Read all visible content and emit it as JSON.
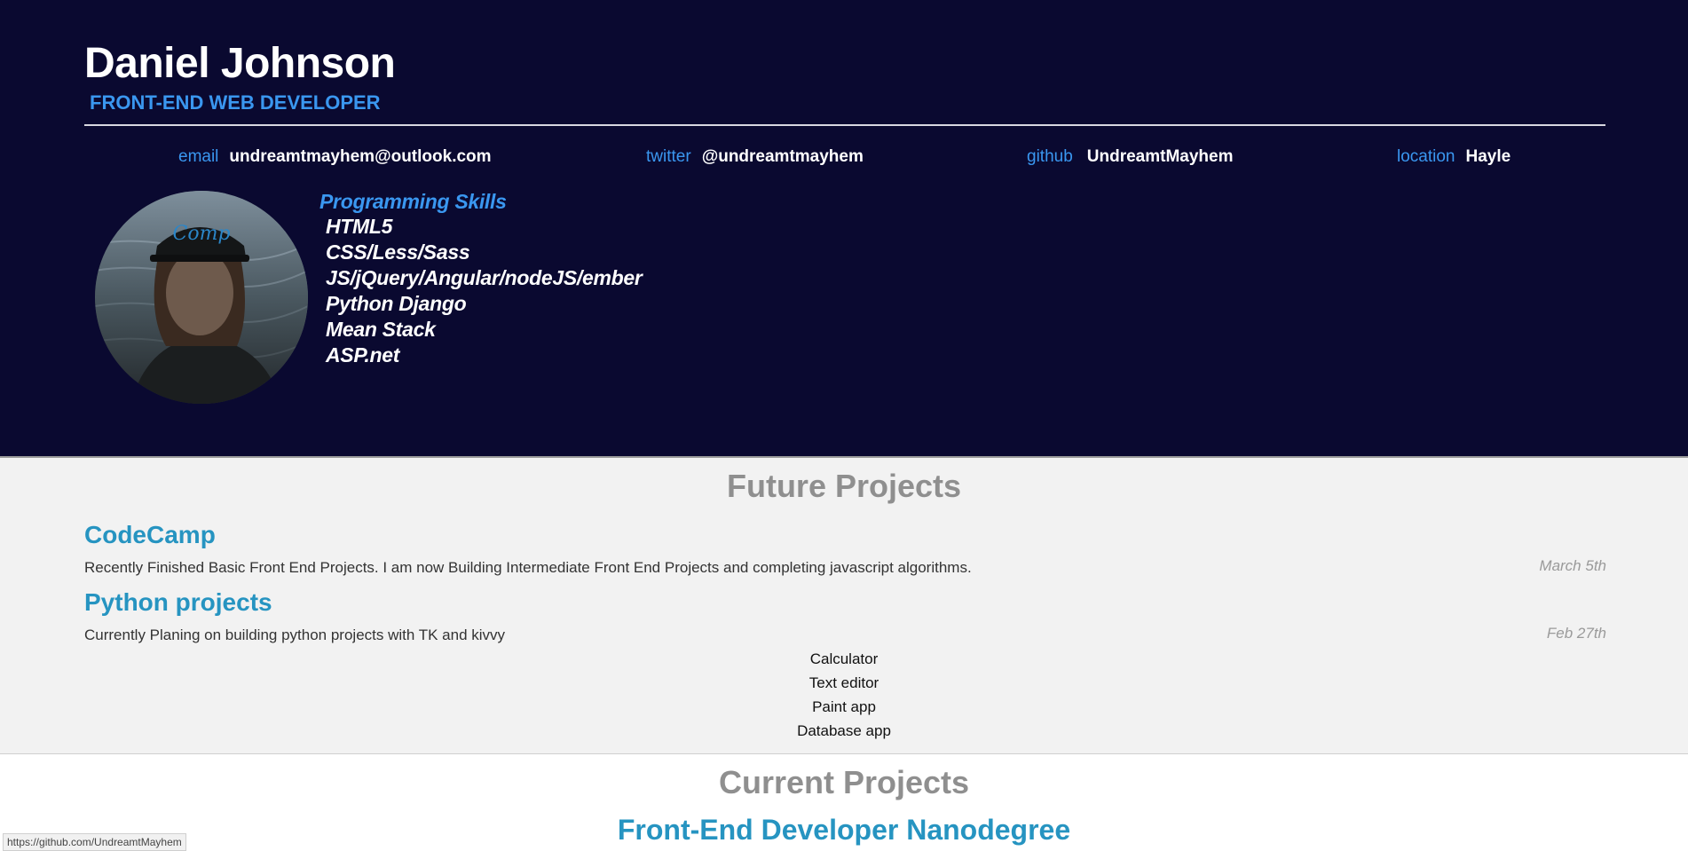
{
  "header": {
    "name": "Daniel Johnson",
    "role": "FRONT-END WEB DEVELOPER",
    "contacts": [
      {
        "label": "email",
        "value": "undreamtmayhem@outlook.com"
      },
      {
        "label": "twitter",
        "value": "@undreamtmayhem"
      },
      {
        "label": "github",
        "value": "UndreamtMayhem"
      },
      {
        "label": "location",
        "value": "Hayle"
      }
    ],
    "avatar_icon": "profile-photo",
    "skills_title": "Programming Skills",
    "skills": [
      "HTML5",
      "CSS/Less/Sass",
      "JS/jQuery/Angular/nodeJS/ember",
      "Python Django",
      "Mean Stack",
      "ASP.net"
    ]
  },
  "future": {
    "title": "Future Projects",
    "projects": [
      {
        "title": "CodeCamp",
        "description": "Recently Finished Basic Front End Projects. I am now Building Intermediate Front End Projects and completing javascript algorithms.",
        "date": "March 5th"
      },
      {
        "title": "Python projects",
        "description": "Currently Planing on building python projects with TK and kivvy",
        "date": "Feb 27th",
        "items": [
          "Calculator",
          "Text editor",
          "Paint app",
          "Database app"
        ]
      }
    ]
  },
  "current": {
    "title": "Current Projects",
    "projects": [
      {
        "title": "Front-End Developer Nanodegree"
      }
    ]
  },
  "status_bar": {
    "url": "https://github.com/UndreamtMayhem"
  },
  "colors": {
    "header_bg": "#0a0930",
    "accent_blue": "#3a97f0",
    "project_title": "#2694c1",
    "section_title": "#8f8f8f",
    "future_bg": "#f2f2f2"
  }
}
